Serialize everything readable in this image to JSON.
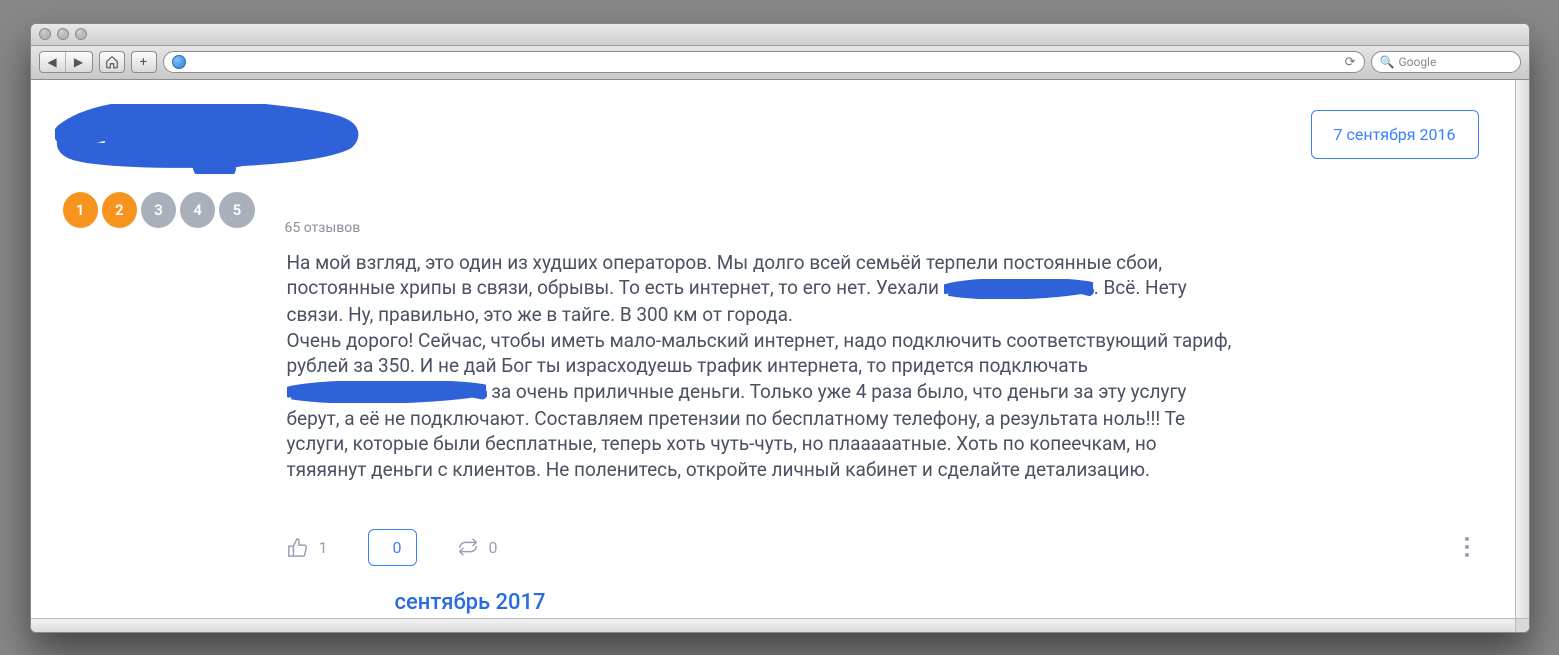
{
  "browser": {
    "search_placeholder": "Google"
  },
  "review": {
    "date": "7 сентября 2016",
    "review_count_label": "65 отзывов",
    "rating": {
      "value": 2,
      "max": 5,
      "labels": [
        "1",
        "2",
        "3",
        "4",
        "5"
      ]
    },
    "text_part1": "На мой взгляд, это один из худших операторов. Мы долго всей семьёй терпели постоянные сбои, постоянные хрипы в связи, обрывы. То есть интернет, то его нет. Уехали ",
    "text_part2": ". Всё. Нету связи. Ну, правильно, это же в тайге. В 300 км от города.",
    "text_part3": "Очень дорого! Сейчас, чтобы иметь мало-мальский интернет, надо подключить соответствующий тариф, рублей за 350. И не дай Бог ты израсходуешь трафик интернета, то придется подключать ",
    "text_part4": " за очень приличные деньги. Только уже 4 раза было, что деньги за эту услугу берут, а её не подключают. Составляем претензии по бесплатному телефону, а результата ноль!!! Те услуги, которые были бесплатные, теперь хоть чуть-чуть, но плааааатные. Хоть по копеечкам, но тяяяянут деньги с клиентов. Не поленитесь, откройте личный кабинет и сделайте детализацию.",
    "likes": "1",
    "comments": "0",
    "shares": "0"
  },
  "footer_month": "сентябрь 2017"
}
